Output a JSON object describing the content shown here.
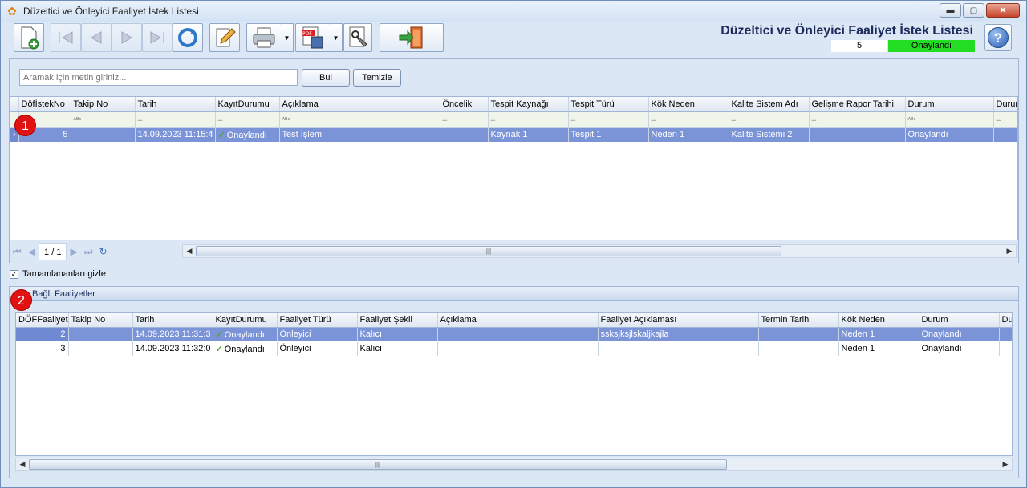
{
  "window": {
    "title": "Düzeltici ve Önleyici Faaliyet İstek Listesi"
  },
  "header": {
    "title": "Düzeltici ve Önleyici Faaliyet İstek Listesi",
    "record_no": "5",
    "status": "Onaylandı",
    "status_color": "#22dd22"
  },
  "search": {
    "placeholder": "Aramak için metin giriniz...",
    "find_label": "Bul",
    "clear_label": "Temizle"
  },
  "grid1": {
    "columns": [
      "DöfİstekNo",
      "Takip No",
      "Tarih",
      "KayıtDurumu",
      "Açıklama",
      "Öncelik",
      "Tespit Kaynağı",
      "Tespit Türü",
      "Kök Neden",
      "Kalite Sistem Adı",
      "Gelişme Rapor Tarihi",
      "Durum",
      "Durum"
    ],
    "rows": [
      {
        "no": "5",
        "takip": "",
        "tarih": "14.09.2023 11:15:4",
        "kayit": "Onaylandı",
        "aciklama": "Test İşlem",
        "oncelik": "",
        "kaynak": "Kaynak 1",
        "tur": "Tespit 1",
        "kok": "Neden 1",
        "kalite": "Kalite Sistemi 2",
        "gelisme": "",
        "durum": "Onaylandı"
      }
    ],
    "pager": "1 / 1"
  },
  "hide_completed": {
    "label": "Tamamlananları gizle",
    "checked": true
  },
  "panel2": {
    "title": "Bağlı Faaliyetler"
  },
  "grid2": {
    "columns": [
      "DÖFFaaliyet",
      "Takip No",
      "Tarih",
      "KayıtDurumu",
      "Faaliyet Türü",
      "Faaliyet Şekli",
      "Açıklama",
      "Faaliyet Açıklaması",
      "Termin Tarihi",
      "Kök Neden",
      "Durum",
      "Dur"
    ],
    "rows": [
      {
        "no": "2",
        "takip": "",
        "tarih": "14.09.2023 11:31:3",
        "kayit": "Onaylandı",
        "tur": "Önleyici",
        "sekil": "Kalıcı",
        "aciklama": "",
        "faaliyet_aciklama": "ssksjksjlskaljkajla",
        "termin": "",
        "kok": "Neden 1",
        "durum": "Onaylandı"
      },
      {
        "no": "3",
        "takip": "",
        "tarih": "14.09.2023 11:32:0",
        "kayit": "Onaylandı",
        "tur": "Önleyici",
        "sekil": "Kalıcı",
        "aciklama": "",
        "faaliyet_aciklama": "",
        "termin": "",
        "kok": "Neden 1",
        "durum": "Onaylandı"
      }
    ]
  },
  "badges": [
    "1",
    "2"
  ]
}
